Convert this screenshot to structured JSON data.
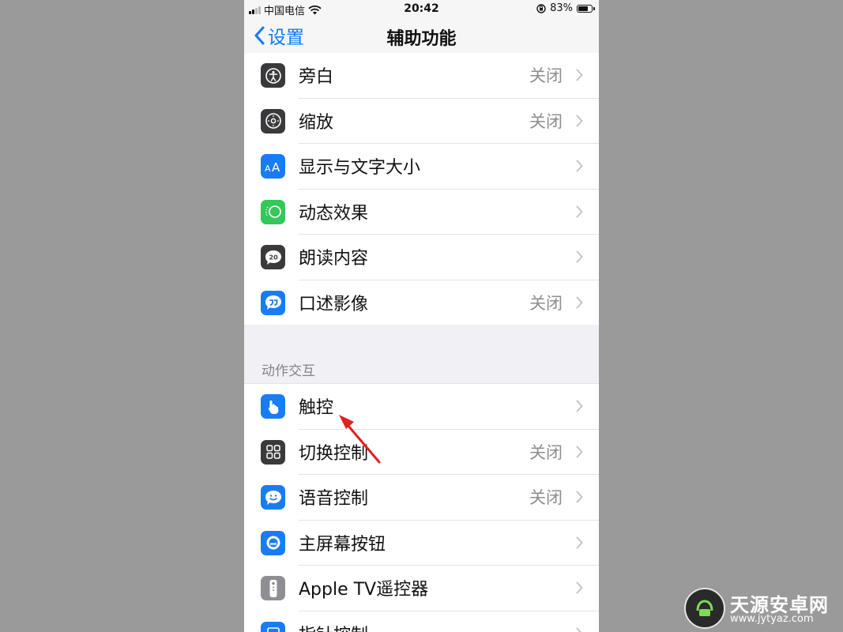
{
  "status_bar": {
    "carrier": "中国电信",
    "time": "20:42",
    "battery_percent_text": "83%",
    "battery_level": 0.83
  },
  "nav": {
    "back_label": "设置",
    "title": "辅助功能"
  },
  "vision_items": [
    {
      "label": "旁白",
      "value": "关闭",
      "icon": "voiceover-icon",
      "icon_color": "#3a3a3c"
    },
    {
      "label": "缩放",
      "value": "关闭",
      "icon": "zoom-icon",
      "icon_color": "#3a3a3c"
    },
    {
      "label": "显示与文字大小",
      "value": "",
      "icon": "text-size-icon",
      "icon_color": "#1a7cf5"
    },
    {
      "label": "动态效果",
      "value": "",
      "icon": "motion-icon",
      "icon_color": "#34c759"
    },
    {
      "label": "朗读内容",
      "value": "",
      "icon": "spoken-content-icon",
      "icon_color": "#3a3a3c"
    },
    {
      "label": "口述影像",
      "value": "关闭",
      "icon": "audio-description-icon",
      "icon_color": "#1a7cf5"
    }
  ],
  "section_header": "动作交互",
  "interaction_items": [
    {
      "label": "触控",
      "value": "",
      "icon": "touch-icon",
      "icon_color": "#1a7cf5"
    },
    {
      "label": "切换控制",
      "value": "关闭",
      "icon": "switch-control-icon",
      "icon_color": "#3a3a3c"
    },
    {
      "label": "语音控制",
      "value": "关闭",
      "icon": "voice-control-icon",
      "icon_color": "#1a7cf5"
    },
    {
      "label": "主屏幕按钮",
      "value": "",
      "icon": "home-button-icon",
      "icon_color": "#1a7cf5"
    },
    {
      "label": "Apple TV遥控器",
      "value": "",
      "icon": "remote-icon",
      "icon_color": "#8e8e93"
    },
    {
      "label": "指针控制",
      "value": "",
      "icon": "pointer-control-icon",
      "icon_color": "#1a7cf5"
    }
  ],
  "watermark": {
    "name": "天源安卓网",
    "url": "www.jytyaz.com"
  }
}
